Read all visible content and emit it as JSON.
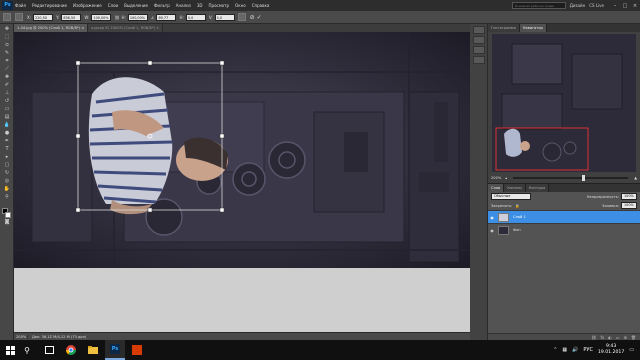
{
  "app": {
    "logo": "Ps"
  },
  "menu": [
    "Файл",
    "Редактирование",
    "Изображение",
    "Слои",
    "Выделение",
    "Фильтр",
    "Анализ",
    "3D",
    "Просмотр",
    "Окно",
    "Справка"
  ],
  "workspace": {
    "search_placeholder": "Основная рабочая среда",
    "label": "Дизайн",
    "cs_live": "CS Live"
  },
  "options_bar": {
    "x": "220,50 пикс",
    "y": "836,50 пикс",
    "w": "100,00%",
    "h": "100,00%",
    "angle": "89,77",
    "h_skew": "0,0",
    "v_skew": "0,0",
    "labels": {
      "x": "X:",
      "y": "Y:",
      "w": "W:",
      "h": "H:",
      "angle": "∠",
      "skew_h": "H:",
      "skew_v": "V:"
    }
  },
  "document_tabs": [
    {
      "label": "1-44.jpg @ 200% (Слой 1, RGB/8*) ×",
      "active": true
    },
    {
      "label": "курсор Ю 2000% (Слой 1, RGB/8*) ×",
      "active": false
    }
  ],
  "status": {
    "zoom": "200%",
    "doc": "Док: 36,1Z М/4,12 М (73 дол)"
  },
  "navigator": {
    "tabs": [
      "Гистограмма",
      "Навигатор"
    ],
    "active_tab": 1,
    "zoom": "200%"
  },
  "layers": {
    "tabs": [
      "Слои",
      "Каналы",
      "Контуры"
    ],
    "active_tab": 0,
    "blend_mode": "Обычные",
    "opacity_label": "Непрозрачность:",
    "opacity": "100%",
    "lock_label": "Закрепить:",
    "fill_label": "Заливка:",
    "fill": "100%",
    "items": [
      {
        "name": "Слой 1",
        "selected": true
      },
      {
        "name": "Фон",
        "selected": false
      }
    ]
  },
  "taskbar": {
    "tray_lang": "РУС",
    "time": "9:43",
    "date": "19.01.2017"
  },
  "colors": {
    "accent": "#3d8fe6",
    "selection_frame": "#e03030",
    "canvas_bg": "#2b2a3a"
  }
}
